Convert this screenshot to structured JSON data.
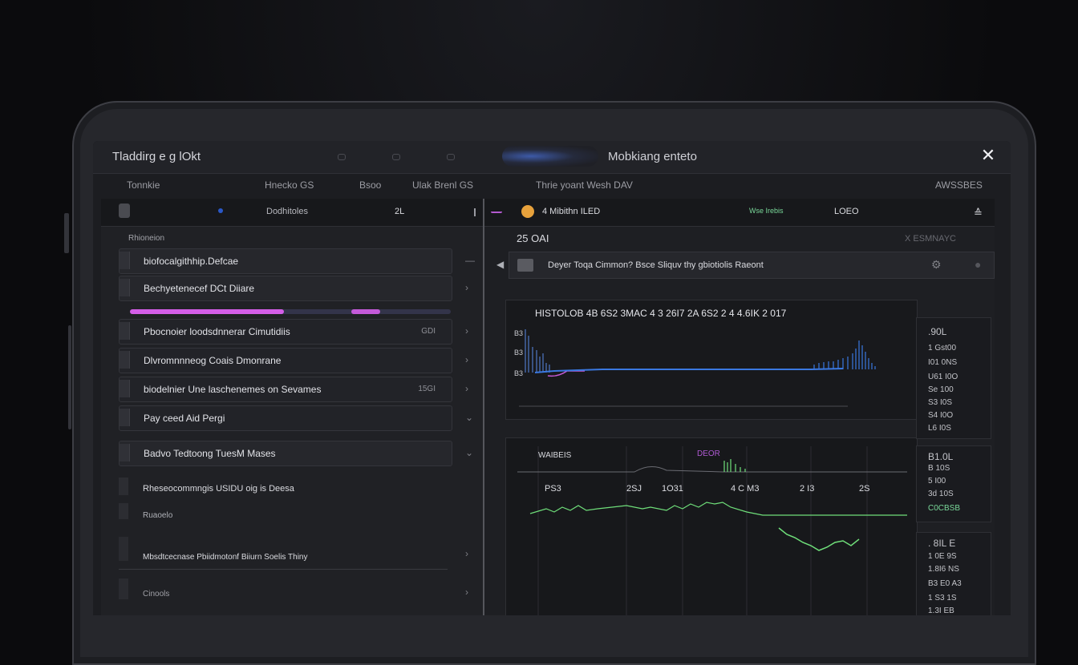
{
  "window": {
    "title": "Tladdirg e g lOkt",
    "center_title": "Mobkiang enteto",
    "close_symbol": "✕"
  },
  "columns": {
    "c1": "Tonnkie",
    "c2": "Hnecko GS",
    "c3": "Bsoo",
    "c4": "Ulak Brenl GS",
    "c5": "Thrie yoant Wesh DAV",
    "c6": "AWSSBES"
  },
  "left": {
    "toolbar_label": "Dodhitoles",
    "toolbar_value": "2L",
    "section_label": "Rhioneion",
    "rows": [
      {
        "label": "biofocalgithhip.Defcae",
        "num": ""
      },
      {
        "label": "Bechyetenecef DCt Diiare",
        "num": ""
      },
      {
        "label": "Pbocnoier loodsdnnerar Cimutidiis",
        "num": "GDI"
      },
      {
        "label": "Dlvromnnneog Coais Dmonrane",
        "num": ""
      },
      {
        "label": "biodelnier Une laschenemes on Sevames",
        "num": "15GI"
      },
      {
        "label": "Pay ceed Aid Pergi",
        "num": ""
      },
      {
        "label": "Badvo Tedtoong TuesM Mases",
        "num": ""
      }
    ],
    "extra": [
      {
        "label": "Rheseocommngis USIDU oig is Deesa"
      },
      {
        "label": "Ruaoelo"
      },
      {
        "label": "Mbsdtcecnase Pbiidmotonf Biiurn Soelis Thiny"
      },
      {
        "label": "Cinools"
      }
    ],
    "progress": {
      "fill": 0.48,
      "fill2_start": 0.69,
      "fill2_end": 0.78
    }
  },
  "right": {
    "toolbar_text": "4 Mibithn ILED",
    "toolbar_pill": "Wse Irebis",
    "toolbar_code": "LOEO",
    "figure_label": "25 OAI",
    "figure_right": "X ESMNAYC",
    "notice": "Deyer Toqa Cimmon? Bsce Sliquv thy gbiotiolis Raeont",
    "chart1_title": "HISTOLOB 4B 6S2 3MAC 4 3 26I7 2A 6S2 2 4 4.6IK 2 017",
    "chart1_yticks": [
      "B3",
      "B3",
      "B3"
    ],
    "chart2_label": "WAIBEIS",
    "chart2_marker": "DEOR",
    "chart2_xticks": [
      "PS3",
      "2SJ",
      "1O31",
      "4 C M3",
      "2 I3",
      "2S"
    ]
  },
  "side_stats": {
    "box1": [
      ".90L",
      "1 Gst00",
      "I01 0NS",
      "U61 I0O",
      "Se 100",
      "S3 I0S",
      "S4 I0O",
      "L6 I0S"
    ],
    "box2": [
      "B1.0L",
      "B 10S",
      "5 I00",
      "3d 10S",
      "C0CBSB"
    ],
    "box3": [
      ". 8IL E",
      "1 0E 9S",
      "1.8I6 NS",
      "B3 E0 A3",
      "1 S3 1S",
      "1.3I EB"
    ]
  },
  "colors": {
    "accent_pink": "#d45ee8",
    "line_blue": "#3a78e0",
    "line_green": "#6fdf7a"
  }
}
